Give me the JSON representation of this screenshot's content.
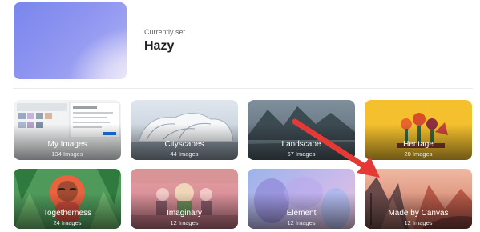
{
  "current": {
    "label": "Currently set",
    "name": "Hazy"
  },
  "collections": [
    {
      "name": "My Images",
      "count": "134 Images"
    },
    {
      "name": "Cityscapes",
      "count": "44 Images"
    },
    {
      "name": "Landscape",
      "count": "67 Images"
    },
    {
      "name": "Heritage",
      "count": "20 Images"
    },
    {
      "name": "Togetherness",
      "count": "24 Images"
    },
    {
      "name": "Imaginary",
      "count": "12 Images"
    },
    {
      "name": "Element",
      "count": "12 Images"
    },
    {
      "name": "Made by Canvas",
      "count": "12 Images"
    }
  ],
  "colors": {
    "annotation_arrow": "#e53935",
    "divider": "#e8eaed"
  }
}
